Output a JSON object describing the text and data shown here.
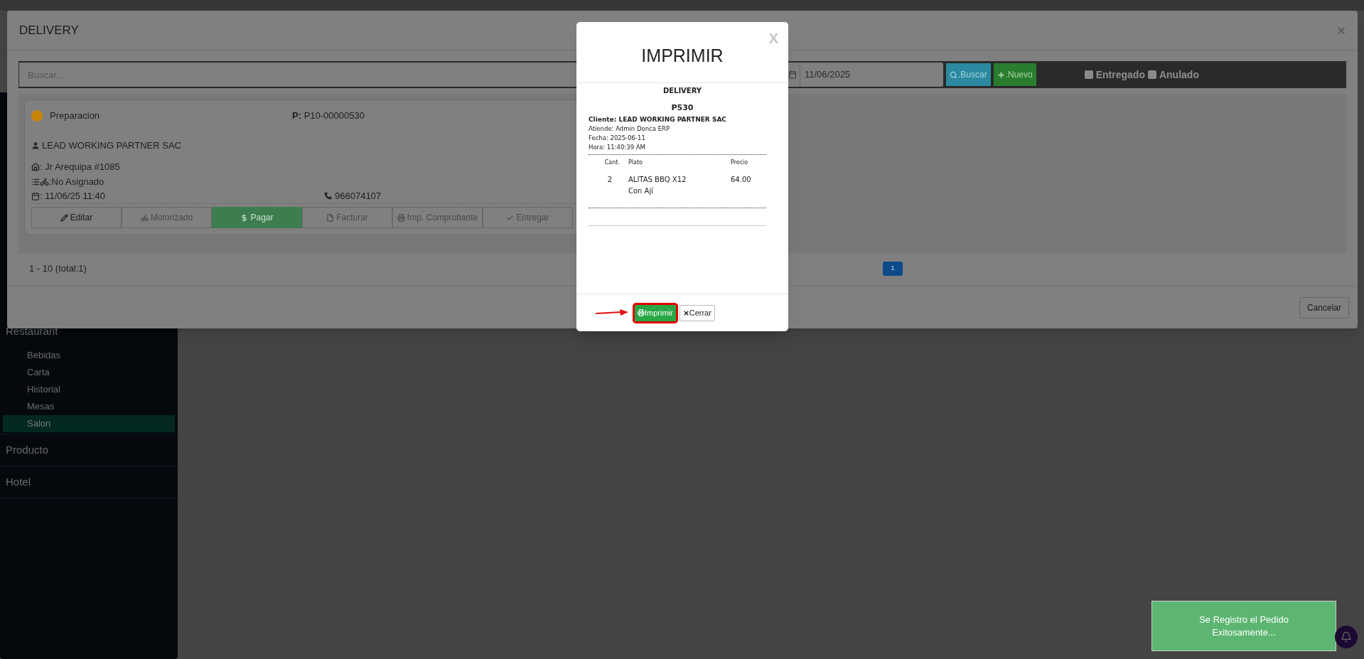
{
  "sidebar": {
    "items": [
      {
        "label": "Restaurant",
        "selected": false,
        "children": [
          {
            "label": "Bebidas",
            "selected": false
          },
          {
            "label": "Carta",
            "selected": false
          },
          {
            "label": "Historial",
            "selected": false
          },
          {
            "label": "Mesas",
            "selected": false
          },
          {
            "label": "Salon",
            "selected": true
          }
        ]
      },
      {
        "label": "Producto",
        "selected": false
      },
      {
        "label": "Hotel",
        "selected": false
      }
    ]
  },
  "delivery_modal": {
    "title": "DELIVERY",
    "close": "×",
    "search": {
      "placeholder": "Buscar..."
    },
    "date": {
      "value": "11/06/2025"
    },
    "buttons": [
      {
        "label": ".Buscar",
        "kind": "search"
      },
      {
        "label": ".Nuevo",
        "kind": "new"
      }
    ],
    "filters": [
      {
        "label": "Entregado",
        "checked": false
      },
      {
        "label": "Anulado",
        "checked": false
      }
    ],
    "orders": [
      {
        "status": "Preparacion",
        "color": "#c8850a",
        "code_label": "P:",
        "code": "P10-00000530",
        "customer": "LEAD WORKING PARTNER SAC",
        "address": ": Jr Arequipa #1085",
        "driver": ":No Asignado",
        "date": ": 11/06/25 11:40",
        "phone": "966074107",
        "actions": [
          {
            "label": "Editar",
            "kind": "default",
            "disabled": false
          },
          {
            "label": "Motorizado",
            "kind": "default",
            "disabled": true
          },
          {
            "label": "Pagar",
            "kind": "success",
            "disabled": false
          },
          {
            "label": "Facturar",
            "kind": "default",
            "disabled": true
          },
          {
            "label": "Imp. Comprobante",
            "kind": "default",
            "disabled": true
          },
          {
            "label": "Entregar",
            "kind": "default",
            "disabled": true
          }
        ]
      }
    ],
    "pagination": {
      "summary": "1 - 10 (total:1)",
      "pages": [
        {
          "label": "1",
          "selected": true
        }
      ]
    },
    "footer_buttons": [
      "Cancelar"
    ]
  },
  "print_modal": {
    "title": "IMPRIMIR",
    "close": "X",
    "receipt": {
      "heading": "DELIVERY",
      "order": "P530",
      "client": "Cliente: LEAD WORKING PARTNER SAC",
      "lines": [
        "Atiende: Admin Donca ERP",
        "Fecha: 2025-06-11",
        "Hora: 11:40:39 AM"
      ],
      "columns": [
        "Cant.",
        "Plato",
        "Precio"
      ],
      "rows": [
        {
          "qty": "2",
          "dish": "ALITAS BBQ X12",
          "note": "Con Ají",
          "price": "64.00"
        }
      ]
    },
    "buttons": [
      {
        "label": "Imprimir",
        "kind": "print",
        "highlighted": true
      },
      {
        "label": "Cerrar",
        "kind": "close",
        "highlighted": false
      }
    ]
  },
  "toast": {
    "message": "Se Registro el Pedido Exitosamente..."
  }
}
